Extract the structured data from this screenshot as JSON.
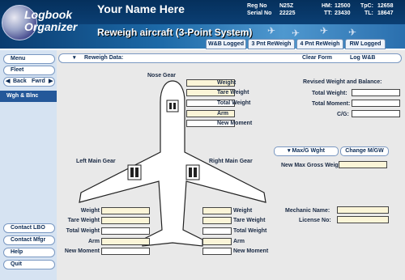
{
  "header": {
    "logo_line1": "Logbook",
    "logo_line2": "Organizer",
    "user_name": "Your Name Here",
    "reg_label": "Reg No",
    "reg_value": "N25Z",
    "serial_label": "Serial No",
    "serial_value": "22225",
    "hm_label": "HM:",
    "hm_value": "12500",
    "tpc_label": "TpC:",
    "tpc_value": "12658",
    "tt_label": "TT:",
    "tt_value": "23430",
    "tl_label": "TL:",
    "tl_value": "18647",
    "page_title": "Reweigh aircraft (3-Point System)"
  },
  "tabs": [
    "W&B Logged",
    "3 Pnt ReWeigh",
    "4 Pnt ReWeigh",
    "RW Logged"
  ],
  "sidebar": {
    "menu": "Menu",
    "fleet": "Fleet",
    "back": "Back",
    "fwrd": "Fwrd",
    "wgh": "Wgh & Blnc",
    "contact_lbo": "Contact LBO",
    "contact_mfgr": "Contact Mfgr",
    "help": "Help",
    "quit": "Quit"
  },
  "strip": {
    "reweigh_data": "Reweigh Data:",
    "clear_form": "Clear Form",
    "log_wb": "Log W&B"
  },
  "nose": {
    "title": "Nose Gear",
    "weight": "Weight",
    "tare": "Tare Weight",
    "total": "Total Weight",
    "arm": "Arm",
    "moment": "New Moment"
  },
  "left_main": {
    "title": "Left Main Gear",
    "weight": "Weight",
    "tare": "Tare Weight",
    "total": "Total Weight",
    "arm": "Arm",
    "moment": "New Moment"
  },
  "right_main": {
    "title": "Right Main Gear",
    "weight": "Weight",
    "tare": "Tare Weight",
    "total": "Total Weight",
    "arm": "Arm",
    "moment": "New Moment"
  },
  "revised": {
    "title": "Revised Weight and Balance:",
    "total_weight": "Total Weight:",
    "total_moment": "Total Moment:",
    "cg": "C/G:"
  },
  "max_gross": {
    "btn_max": "Max/G Wght",
    "btn_change": "Change M/GW",
    "new_max": "New Max Gross Weight:"
  },
  "mechanic": {
    "name": "Mechanic Name:",
    "license": "License No:"
  },
  "colors": {
    "header_bg": "#05305c",
    "sidebar_bg": "#d6e3f2",
    "active_side": "#24589a",
    "field_bg": "#fbf5d8"
  }
}
